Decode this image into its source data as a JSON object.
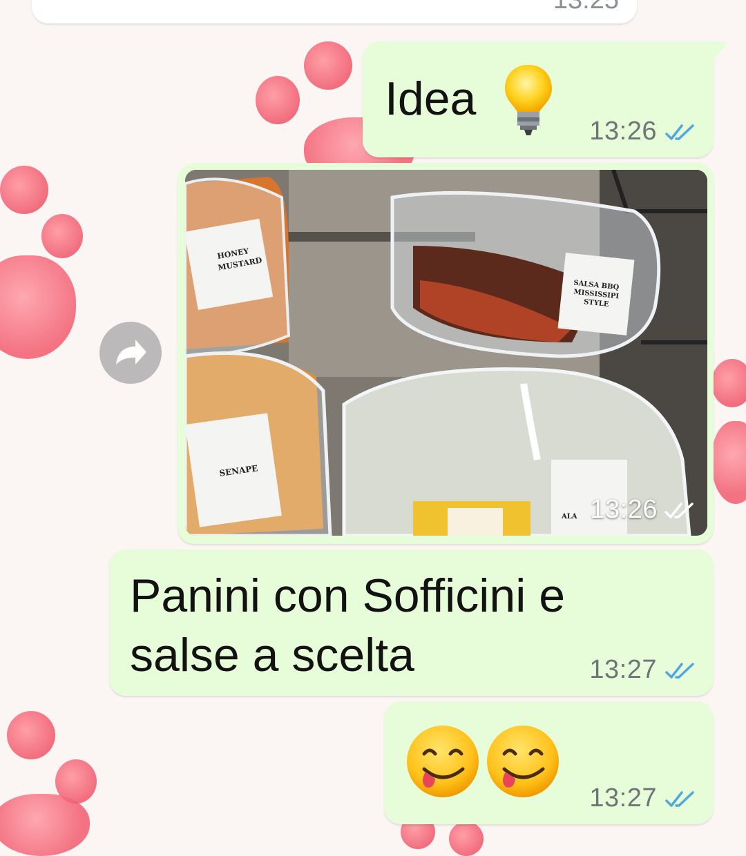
{
  "chat": {
    "previous_message": {
      "time": "13:25"
    },
    "messages": [
      {
        "type": "text",
        "text": "Idea",
        "emoji": "light-bulb",
        "time": "13:26",
        "status": "read"
      },
      {
        "type": "image",
        "time": "13:26",
        "status": "read",
        "photo_labels": {
          "honey": "HONEY MUSTARD",
          "bbq_line1": "SALSA BBQ",
          "bbq_line2": "MISSISSIPI",
          "bbq_line3": "STYLE",
          "senape": "SENAPE",
          "partial": "ALA"
        }
      },
      {
        "type": "text",
        "line1": "Panini con Sofficini e",
        "line2": "salse a scelta",
        "time": "13:27",
        "status": "read"
      },
      {
        "type": "emoji",
        "emojis": [
          "face-savoring-food",
          "face-savoring-food"
        ],
        "time": "13:27",
        "status": "read"
      }
    ]
  },
  "colors": {
    "outgoing_bubble": "#e7fcd8",
    "read_ticks": "#4fa8e0",
    "background": "#fbf6f4"
  }
}
